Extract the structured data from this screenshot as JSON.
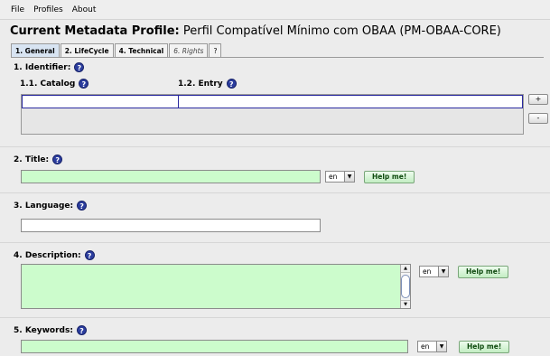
{
  "menu": [
    "File",
    "Profiles",
    "About"
  ],
  "profile": {
    "label": "Current Metadata Profile:",
    "name": "Perfil Compatível Mínimo com OBAA (PM-OBAA-CORE)"
  },
  "tabs": [
    {
      "label": "1. General",
      "state": "active"
    },
    {
      "label": "2. LifeCycle",
      "state": "bold"
    },
    {
      "label": "4. Technical",
      "state": "bold"
    },
    {
      "label": "6. Rights",
      "state": "italic"
    },
    {
      "label": "?",
      "state": "plain"
    }
  ],
  "help_icon": "?",
  "identifier": {
    "label": "1. Identifier:",
    "catalog_label": "1.1. Catalog",
    "entry_label": "1.2. Entry",
    "add_button": "+",
    "remove_button": "-"
  },
  "title": {
    "label": "2. Title:",
    "value": "",
    "lang": "en",
    "help_button": "Help me!"
  },
  "language": {
    "label": "3. Language:",
    "value": ""
  },
  "description": {
    "label": "4. Description:",
    "value": "",
    "lang": "en",
    "help_button": "Help me!"
  },
  "keywords": {
    "label": "5. Keywords:",
    "value": "",
    "lang": "en",
    "help_button": "Help me!"
  },
  "colors": {
    "required_field": "#ccfccc",
    "help_icon": "#2b3d9e",
    "active_tab": "#d8e4f2",
    "table_border": "#2a2aa0"
  }
}
